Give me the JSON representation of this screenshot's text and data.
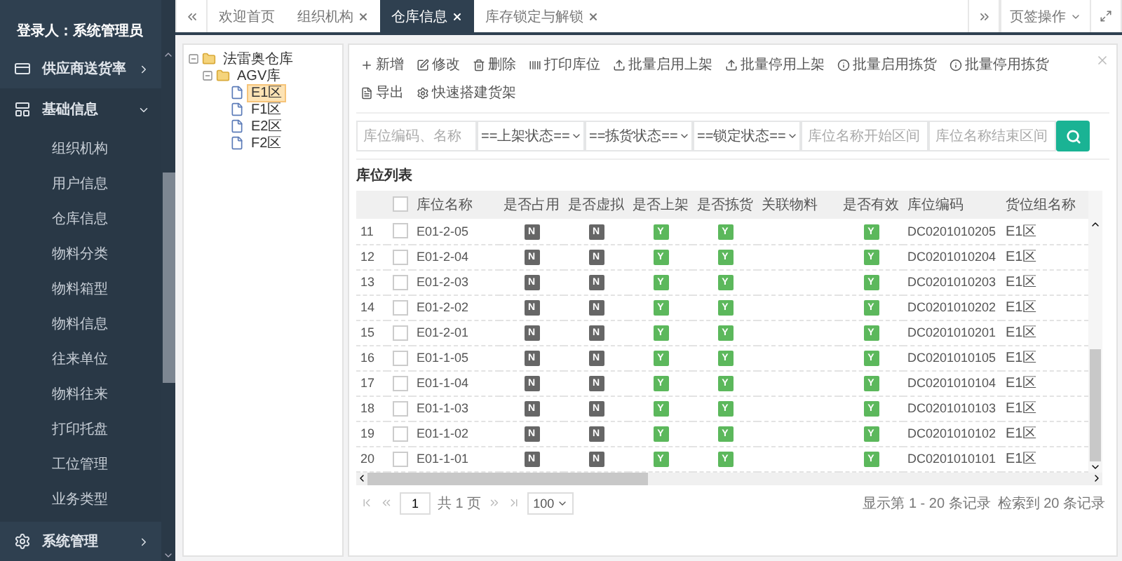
{
  "sidebar": {
    "user": "登录人：系统管理员",
    "menu": [
      {
        "kind": "payment",
        "label": "供应商送货率",
        "expanded": false
      },
      {
        "kind": "basic",
        "label": "基础信息",
        "expanded": true,
        "children": [
          {
            "label": "组织机构"
          },
          {
            "label": "用户信息"
          },
          {
            "label": "仓库信息"
          },
          {
            "label": "物料分类"
          },
          {
            "label": "物料箱型"
          },
          {
            "label": "物料信息"
          },
          {
            "label": "往来单位"
          },
          {
            "label": "物料往来"
          },
          {
            "label": "打印托盘"
          },
          {
            "label": "工位管理"
          },
          {
            "label": "业务类型"
          }
        ]
      },
      {
        "kind": "system",
        "label": "系统管理",
        "expanded": false
      }
    ]
  },
  "tabs": [
    {
      "label": "欢迎首页",
      "closable": false,
      "selected": false
    },
    {
      "label": "组织机构",
      "closable": true,
      "selected": false
    },
    {
      "label": "仓库信息",
      "closable": true,
      "selected": true
    },
    {
      "label": "库存锁定与解锁",
      "closable": true,
      "selected": false
    }
  ],
  "tab_menu": "页签操作",
  "tree": {
    "label": "法雷奥仓库",
    "expanded": true,
    "children": [
      {
        "label": "AGV库",
        "expanded": true,
        "children": [
          {
            "label": "E1区",
            "selected": true
          },
          {
            "label": "F1区",
            "selected": false
          },
          {
            "label": "E2区",
            "selected": false
          },
          {
            "label": "F2区",
            "selected": false
          }
        ]
      }
    ]
  },
  "toolbar": [
    {
      "kind": "add",
      "label": "新增"
    },
    {
      "kind": "edit",
      "label": "修改"
    },
    {
      "kind": "delete",
      "label": "删除"
    },
    {
      "kind": "print",
      "label": "打印库位"
    },
    {
      "kind": "upload",
      "label": "批量启用上架"
    },
    {
      "kind": "upload",
      "label": "批量停用上架"
    },
    {
      "kind": "info",
      "label": "批量启用拣货"
    },
    {
      "kind": "info",
      "label": "批量停用拣货"
    },
    {
      "kind": "export",
      "label": "导出"
    },
    {
      "kind": "gear",
      "label": "快速搭建货架"
    }
  ],
  "filters": [
    {
      "kind": "text",
      "placeholder": "库位编码、名称"
    },
    {
      "kind": "select",
      "value": "==上架状态=="
    },
    {
      "kind": "select",
      "value": "==拣货状态=="
    },
    {
      "kind": "select",
      "value": "==锁定状态=="
    },
    {
      "kind": "text",
      "placeholder": "库位名称开始区间"
    },
    {
      "kind": "text",
      "placeholder": "库位名称结束区间"
    }
  ],
  "table": {
    "title": "库位列表",
    "all_checked": false,
    "columns": [
      "库位名称",
      "是否占用",
      "是否虚拟",
      "是否上架",
      "是否拣货",
      "关联物料",
      "是否有效",
      "库位编码",
      "货位组名称"
    ],
    "rows": [
      {
        "index": "11",
        "checked": false,
        "name": "E01-2-05",
        "flags": [
          {
            "text": "N",
            "on": false
          },
          {
            "text": "N",
            "on": false
          },
          {
            "text": "Y",
            "on": true
          },
          {
            "text": "Y",
            "on": true
          }
        ],
        "valid": {
          "text": "Y",
          "on": true
        },
        "code": "DC0201010205",
        "group": "E1区"
      },
      {
        "index": "12",
        "checked": false,
        "name": "E01-2-04",
        "flags": [
          {
            "text": "N",
            "on": false
          },
          {
            "text": "N",
            "on": false
          },
          {
            "text": "Y",
            "on": true
          },
          {
            "text": "Y",
            "on": true
          }
        ],
        "valid": {
          "text": "Y",
          "on": true
        },
        "code": "DC0201010204",
        "group": "E1区"
      },
      {
        "index": "13",
        "checked": false,
        "name": "E01-2-03",
        "flags": [
          {
            "text": "N",
            "on": false
          },
          {
            "text": "N",
            "on": false
          },
          {
            "text": "Y",
            "on": true
          },
          {
            "text": "Y",
            "on": true
          }
        ],
        "valid": {
          "text": "Y",
          "on": true
        },
        "code": "DC0201010203",
        "group": "E1区"
      },
      {
        "index": "14",
        "checked": false,
        "name": "E01-2-02",
        "flags": [
          {
            "text": "N",
            "on": false
          },
          {
            "text": "N",
            "on": false
          },
          {
            "text": "Y",
            "on": true
          },
          {
            "text": "Y",
            "on": true
          }
        ],
        "valid": {
          "text": "Y",
          "on": true
        },
        "code": "DC0201010202",
        "group": "E1区"
      },
      {
        "index": "15",
        "checked": false,
        "name": "E01-2-01",
        "flags": [
          {
            "text": "N",
            "on": false
          },
          {
            "text": "N",
            "on": false
          },
          {
            "text": "Y",
            "on": true
          },
          {
            "text": "Y",
            "on": true
          }
        ],
        "valid": {
          "text": "Y",
          "on": true
        },
        "code": "DC0201010201",
        "group": "E1区"
      },
      {
        "index": "16",
        "checked": false,
        "name": "E01-1-05",
        "flags": [
          {
            "text": "N",
            "on": false
          },
          {
            "text": "N",
            "on": false
          },
          {
            "text": "Y",
            "on": true
          },
          {
            "text": "Y",
            "on": true
          }
        ],
        "valid": {
          "text": "Y",
          "on": true
        },
        "code": "DC0201010105",
        "group": "E1区"
      },
      {
        "index": "17",
        "checked": false,
        "name": "E01-1-04",
        "flags": [
          {
            "text": "N",
            "on": false
          },
          {
            "text": "N",
            "on": false
          },
          {
            "text": "Y",
            "on": true
          },
          {
            "text": "Y",
            "on": true
          }
        ],
        "valid": {
          "text": "Y",
          "on": true
        },
        "code": "DC0201010104",
        "group": "E1区"
      },
      {
        "index": "18",
        "checked": false,
        "name": "E01-1-03",
        "flags": [
          {
            "text": "N",
            "on": false
          },
          {
            "text": "N",
            "on": false
          },
          {
            "text": "Y",
            "on": true
          },
          {
            "text": "Y",
            "on": true
          }
        ],
        "valid": {
          "text": "Y",
          "on": true
        },
        "code": "DC0201010103",
        "group": "E1区"
      },
      {
        "index": "19",
        "checked": false,
        "name": "E01-1-02",
        "flags": [
          {
            "text": "N",
            "on": false
          },
          {
            "text": "N",
            "on": false
          },
          {
            "text": "Y",
            "on": true
          },
          {
            "text": "Y",
            "on": true
          }
        ],
        "valid": {
          "text": "Y",
          "on": true
        },
        "code": "DC0201010102",
        "group": "E1区"
      },
      {
        "index": "20",
        "checked": false,
        "name": "E01-1-01",
        "flags": [
          {
            "text": "N",
            "on": false
          },
          {
            "text": "N",
            "on": false
          },
          {
            "text": "Y",
            "on": true
          },
          {
            "text": "Y",
            "on": true
          }
        ],
        "valid": {
          "text": "Y",
          "on": true
        },
        "code": "DC0201010101",
        "group": "E1区"
      }
    ]
  },
  "pagination": {
    "page": "1",
    "total_pages": "共 1 页",
    "page_size": "100",
    "range": "显示第 1 - 20 条记录",
    "count": "检索到 20 条记录"
  }
}
